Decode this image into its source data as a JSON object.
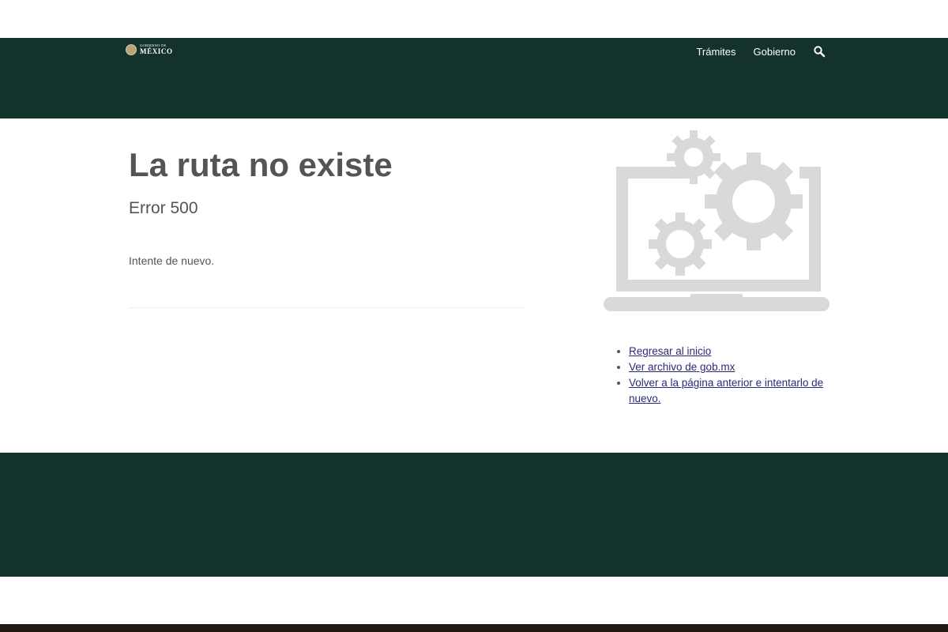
{
  "header": {
    "logo_line1": "GOBIERNO DE",
    "logo_line2": "MÉXICO",
    "nav": {
      "tramites": "Trámites",
      "gobierno": "Gobierno"
    }
  },
  "main": {
    "title": "La ruta no existe",
    "subtitle": "Error 500",
    "message": "Intente de nuevo.",
    "links": [
      "Regresar al inicio",
      "Ver archivo de gob.mx",
      "Volver a la página anterior e intentarlo de nuevo."
    ]
  },
  "colors": {
    "header_bg": "#13322b",
    "text": "#545454",
    "link": "#2a2a7a",
    "illustration": "#d9d9d9"
  }
}
